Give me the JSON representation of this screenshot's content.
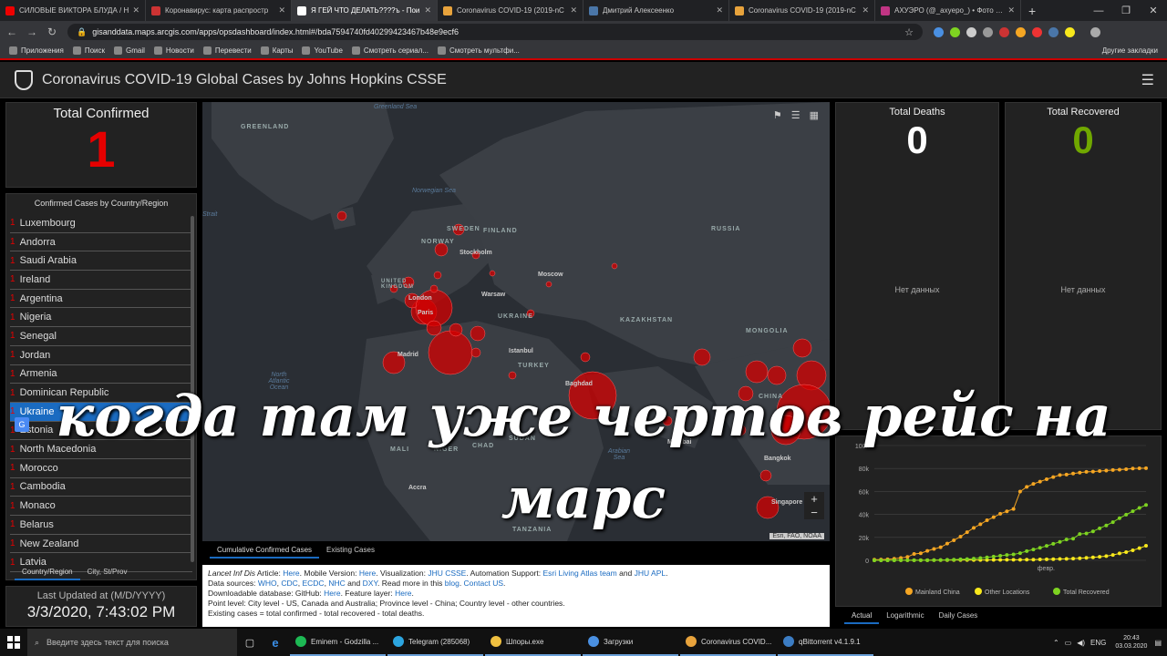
{
  "tabs": [
    {
      "title": "СИЛОВЫЕ ВИКТОРА БЛУДА / Н",
      "color": "#e00"
    },
    {
      "title": "Коронавирус: карта распростр",
      "color": "#c33"
    },
    {
      "title": "Я ГЕЙ ЧТО ДЕЛАТЬ????ъ - Пои",
      "color": "#fff",
      "active": true
    },
    {
      "title": "Coronavirus COVID-19 (2019-nC",
      "color": "#e8a33c"
    },
    {
      "title": "Дмитрий Алексеенко",
      "color": "#4a76a8"
    },
    {
      "title": "Coronavirus COVID-19 (2019-nC",
      "color": "#e8a33c"
    },
    {
      "title": "АХУЭРО (@_axyepo_) • Фото и в",
      "color": "#c13584"
    }
  ],
  "address": {
    "url": "gisanddata.maps.arcgis.com/apps/opsdashboard/index.html#/bda7594740fd40299423467b48e9ecf6"
  },
  "bookmarks": [
    "Приложения",
    "Поиск",
    "Gmail",
    "Новости",
    "Перевести",
    "Карты",
    "YouTube",
    "Смотреть сериал...",
    "Смотреть мультфи..."
  ],
  "bookmarks_other": "Другие закладки",
  "app": {
    "title": "Coronavirus COVID-19 Global Cases by Johns Hopkins CSSE"
  },
  "total_confirmed": {
    "label": "Total Confirmed",
    "value": "1"
  },
  "country_list": {
    "header": "Confirmed Cases by Country/Region",
    "items": [
      {
        "count": "1",
        "name": "Luxembourg"
      },
      {
        "count": "1",
        "name": "Andorra"
      },
      {
        "count": "1",
        "name": "Saudi Arabia"
      },
      {
        "count": "1",
        "name": "Ireland"
      },
      {
        "count": "1",
        "name": "Argentina"
      },
      {
        "count": "1",
        "name": "Nigeria"
      },
      {
        "count": "1",
        "name": "Senegal"
      },
      {
        "count": "1",
        "name": "Jordan"
      },
      {
        "count": "1",
        "name": "Armenia"
      },
      {
        "count": "1",
        "name": "Dominican Republic"
      },
      {
        "count": "1",
        "name": "Ukraine"
      },
      {
        "count": "1",
        "name": "Estonia"
      },
      {
        "count": "1",
        "name": "North Macedonia"
      },
      {
        "count": "1",
        "name": "Morocco"
      },
      {
        "count": "1",
        "name": "Cambodia"
      },
      {
        "count": "1",
        "name": "Monaco"
      },
      {
        "count": "1",
        "name": "Belarus"
      },
      {
        "count": "1",
        "name": "New Zealand"
      },
      {
        "count": "1",
        "name": "Latvia"
      }
    ],
    "tabs": [
      "Country/Region",
      "City, St/Prov"
    ]
  },
  "last_updated": {
    "label": "Last Updated at (M/D/YYYY)",
    "value": "3/3/2020, 7:43:02 PM"
  },
  "map": {
    "labels": {
      "greenland": "GREENLAND",
      "sweden": "SWEDEN",
      "finland": "FINLAND",
      "norway": "NORWAY",
      "russia": "RUSSIA",
      "ukraine": "UKRAINE",
      "kazakhstan": "KAZAKHSTAN",
      "mongolia": "MONGOLIA",
      "turkey": "TURKEY",
      "mali": "MALI",
      "niger": "NIGER",
      "chad": "CHAD",
      "sudan": "SUDAN",
      "china": "CHINA",
      "tanzania": "TANZANIA",
      "united_kingdom": "UNITED KINGDOM"
    },
    "seas": {
      "greenland_sea": "Greenland Sea",
      "norwegian_sea": "Norwegian Sea",
      "north_atlantic": "North Atlantic Ocean",
      "arabian_sea": "Arabian Sea",
      "strait": "Strait"
    },
    "cities": {
      "moscow": "Moscow",
      "stockholm": "Stockholm",
      "warsaw": "Warsaw",
      "london": "London",
      "paris": "Paris",
      "madrid": "Madrid",
      "istanbul": "Istanbul",
      "baghdad": "Baghdad",
      "accra": "Accra",
      "mumbai": "Mumbai",
      "bangkok": "Bangkok",
      "singapore": "Singapore"
    },
    "attribution": "Esri, FAO, NOAA",
    "tabs": [
      "Cumulative Confirmed Cases",
      "Existing Cases"
    ]
  },
  "info": {
    "l1a": "Lancet Inf Dis",
    "l1b": " Article: ",
    "l1c": "Here",
    "l1d": ". Mobile Version: ",
    "l1e": "Here",
    "l1f": ". Visualization: ",
    "l1g": "JHU CSSE",
    "l1h": ". Automation Support: ",
    "l1i": "Esri Living Atlas team",
    "l1j": " and ",
    "l1k": "JHU APL",
    "l1l": ".",
    "l2a": "Data sources: ",
    "l2b": "WHO",
    "l2c": ", ",
    "l2d": "CDC",
    "l2e": ", ",
    "l2f": "ECDC",
    "l2g": ", ",
    "l2h": "NHC",
    "l2i": " and ",
    "l2j": "DXY",
    "l2k": ". Read more in this ",
    "l2l": "blog",
    "l2m": ". ",
    "l2n": "Contact US",
    "l2o": ".",
    "l3a": "Downloadable database: GitHub: ",
    "l3b": "Here",
    "l3c": ". Feature layer: ",
    "l3d": "Here",
    "l3e": ".",
    "l4": "Point level: City level - US, Canada and Australia; Province level - China; Country level - other countries.",
    "l5": "Existing cases = total confirmed - total recovered - total deaths."
  },
  "total_deaths": {
    "label": "Total Deaths",
    "value": "0",
    "no_data": "Нет данных"
  },
  "total_recovered": {
    "label": "Total Recovered",
    "value": "0",
    "no_data": "Нет данных"
  },
  "chart_tabs": [
    "Actual",
    "Logarithmic",
    "Daily Cases"
  ],
  "chart_data": {
    "type": "line",
    "xlabel": "февр.",
    "ylabel": "",
    "ylim": [
      0,
      100000
    ],
    "yticks": [
      "0",
      "20k",
      "40k",
      "60k",
      "80k",
      "100k"
    ],
    "x_points": 42,
    "series": [
      {
        "name": "Mainland China",
        "color": "#f5a623",
        "values": [
          555,
          653,
          941,
          1438,
          2118,
          2927,
          5578,
          6166,
          8234,
          9927,
          11374,
          14575,
          17488,
          20626,
          24553,
          28276,
          31439,
          34876,
          37552,
          40553,
          42708,
          44730,
          59907,
          63950,
          66580,
          68584,
          70635,
          72528,
          74280,
          74675,
          75569,
          76392,
          77042,
          77262,
          77779,
          78190,
          78630,
          78959,
          79389,
          79968,
          80174,
          80304
        ]
      },
      {
        "name": "Other Locations",
        "color": "#f8e81c",
        "values": [
          10,
          27,
          38,
          61,
          68,
          84,
          113,
          125,
          137,
          177,
          204,
          227,
          253,
          270,
          291,
          317,
          331,
          339,
          366,
          394,
          451,
          463,
          496,
          571,
          644,
          758,
          895,
          1028,
          1164,
          1272,
          1472,
          1813,
          2204,
          2578,
          3117,
          3664,
          4691,
          6009,
          7169,
          8774,
          10566,
          12668
        ]
      },
      {
        "name": "Total Recovered",
        "color": "#7ed321",
        "values": [
          28,
          30,
          36,
          39,
          52,
          61,
          107,
          126,
          143,
          222,
          284,
          472,
          623,
          852,
          1124,
          1487,
          2011,
          2616,
          3244,
          3946,
          4683,
          5150,
          6295,
          8058,
          9395,
          10865,
          12583,
          14352,
          16121,
          18177,
          18890,
          22886,
          23394,
          25227,
          27905,
          30384,
          33277,
          36711,
          39782,
          42716,
          45602,
          48228
        ]
      }
    ]
  },
  "overlay": {
    "line1": "когда там уже чертов рейс на",
    "line2": "марс"
  },
  "taskbar": {
    "search_placeholder": "Введите здесь текст для поиска",
    "apps": [
      {
        "label": "Eminem - Godzilla ...",
        "color": "#1db954"
      },
      {
        "label": "Telegram (285068)",
        "color": "#2ca5e0"
      },
      {
        "label": "Шпоры.exe",
        "color": "#f0c040"
      },
      {
        "label": "Загрузки",
        "color": "#4a90e2"
      },
      {
        "label": "Coronavirus COVID...",
        "color": "#e8a33c"
      },
      {
        "label": "qBittorrent v4.1.9.1",
        "color": "#3c7dc4"
      }
    ],
    "lang": "ENG",
    "time": "20:43",
    "date": "03.03.2020"
  }
}
